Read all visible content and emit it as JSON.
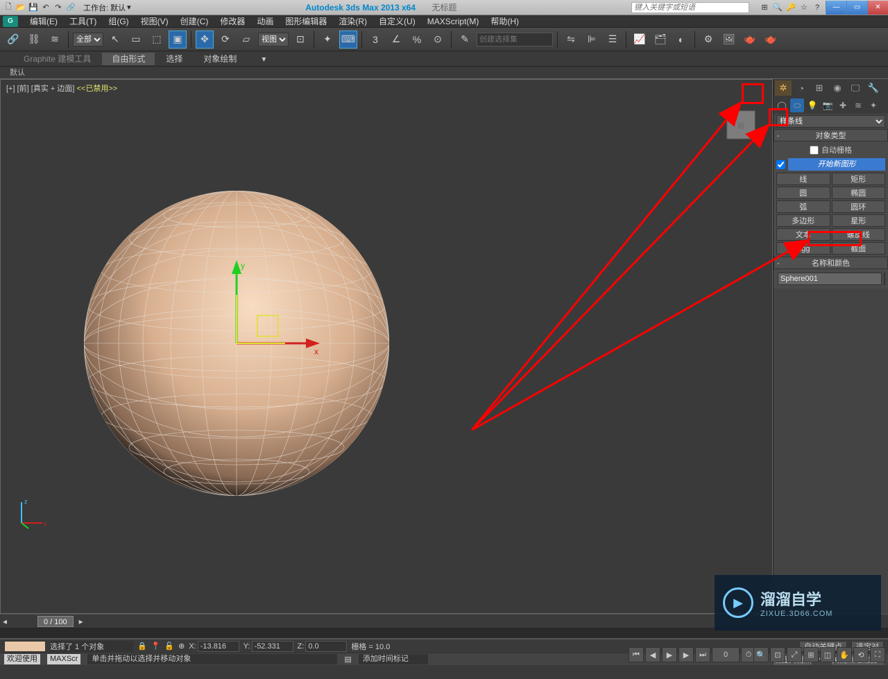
{
  "titlebar": {
    "workspace_label": "工作台: 默认",
    "app_title": "Autodesk 3ds Max  2013 x64",
    "doc_title": "无标题",
    "search_placeholder": "键入关键字或短语"
  },
  "menu": {
    "items": [
      "编辑(E)",
      "工具(T)",
      "组(G)",
      "视图(V)",
      "创建(C)",
      "修改器",
      "动画",
      "图形编辑器",
      "渲染(R)",
      "自定义(U)",
      "MAXScript(M)",
      "帮助(H)"
    ]
  },
  "main_toolbar": {
    "filter_all": "全部",
    "view_dd": "视图",
    "named_set_placeholder": "创建选择集"
  },
  "ribbon": {
    "tabs": [
      "Graphite 建模工具",
      "自由形式",
      "选择",
      "对象绘制"
    ],
    "sub": "默认"
  },
  "viewport": {
    "label_prefix": "[+] [前]",
    "label_mode": "[真实 + 边面]",
    "label_disabled": "<<已禁用>>"
  },
  "cmd": {
    "dropdown": "样条线",
    "rollout_type": "对象类型",
    "autogrid": "自动栅格",
    "start_new": "开始新图形",
    "buttons": [
      "线",
      "矩形",
      "圆",
      "椭圆",
      "弧",
      "圆环",
      "多边形",
      "星形",
      "文本",
      "螺旋线",
      "Egg",
      "截面"
    ],
    "rollout_name": "名称和颜色",
    "object_name": "Sphere001"
  },
  "timeline": {
    "frame": "0 / 100"
  },
  "coords": {
    "x_label": "X:",
    "x_val": "-13.816",
    "y_label": "Y:",
    "y_val": "-52.331",
    "z_label": "Z:",
    "z_val": "0.0",
    "grid": "栅格 = 10.0",
    "autokey": "自动关键点",
    "selset": "选定对",
    "setkey": "设置关键点",
    "keyfilter": "关键点过滤器..."
  },
  "status": {
    "sel": "选择了 1 个对象",
    "hint": "单击并拖动以选择并移动对象",
    "addtime": "添加时间标记",
    "welcome": "欢迎使用",
    "maxsc": "MAXScr"
  },
  "watermark": {
    "big": "溜溜自学",
    "small": "ZIXUE.3D66.COM"
  }
}
